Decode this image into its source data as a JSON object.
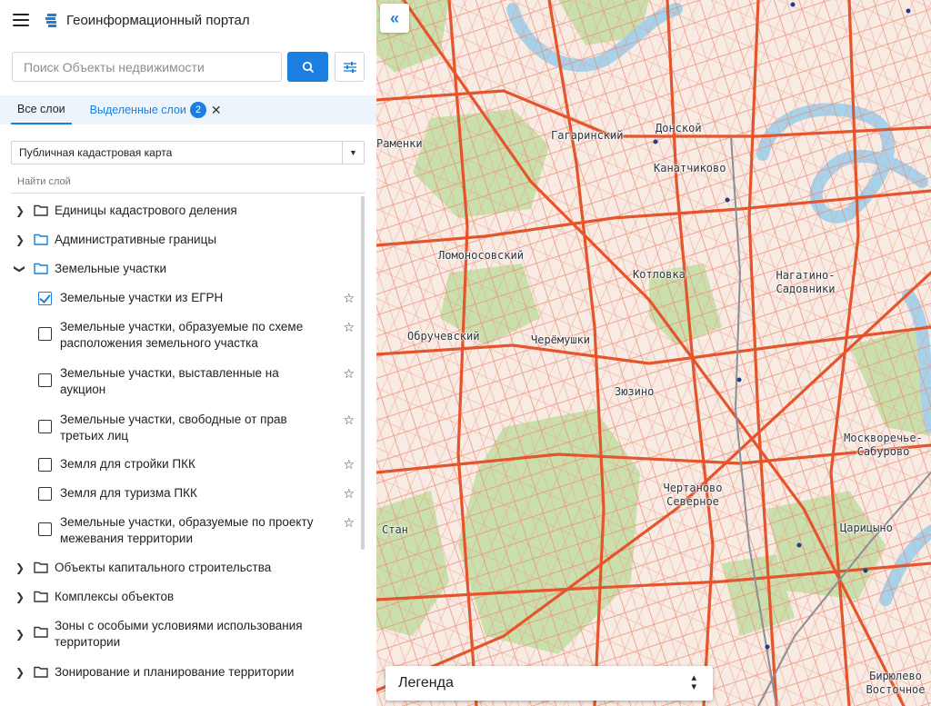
{
  "header": {
    "title": "Геоинформационный портал"
  },
  "search": {
    "placeholder": "Поиск Объекты недвижимости"
  },
  "tabs": {
    "all": "Все слои",
    "selected": "Выделенные слои",
    "selected_count": "2"
  },
  "basemap": {
    "selected": "Публичная кадастровая карта"
  },
  "find_layer": {
    "placeholder": "Найти слой"
  },
  "tree": [
    {
      "label": "Единицы кадастрового деления",
      "type": "folder",
      "expanded": false
    },
    {
      "label": "Административные границы",
      "type": "folder",
      "expanded": false
    },
    {
      "label": "Земельные участки",
      "type": "folder",
      "expanded": true
    },
    {
      "label": "Земельные участки из ЕГРН",
      "type": "layer",
      "checked": true
    },
    {
      "label": "Земельные участки, образуемые по схеме расположения земельного участка",
      "type": "layer",
      "checked": false
    },
    {
      "label": "Земельные участки, выставленные на аукцион",
      "type": "layer",
      "checked": false
    },
    {
      "label": "Земельные участки, свободные от прав третьих лиц",
      "type": "layer",
      "checked": false
    },
    {
      "label": "Земля для стройки ПКК",
      "type": "layer",
      "checked": false
    },
    {
      "label": "Земля для туризма ПКК",
      "type": "layer",
      "checked": false
    },
    {
      "label": "Земельные участки, образуемые по проекту межевания территории",
      "type": "layer",
      "checked": false
    },
    {
      "label": "Объекты капитального строительства",
      "type": "folder",
      "expanded": false
    },
    {
      "label": "Комплексы объектов",
      "type": "folder",
      "expanded": false
    },
    {
      "label": "Зоны с особыми условиями использования территории",
      "type": "folder",
      "expanded": false
    },
    {
      "label": "Зонирование и планирование территории",
      "type": "folder",
      "expanded": false
    }
  ],
  "map": {
    "legend_label": "Легенда",
    "labels": [
      "Раменки",
      "Гагаринский",
      "Донской",
      "Канатчиково",
      "Ломоносовский",
      "Котловка",
      "Нагатино-Садовники",
      "Обручевский",
      "Черёмушки",
      "Зюзино",
      "Москворечье-Сабурово",
      "Чертаново Северное",
      "Стан",
      "Царицыно",
      "Бирюлево Восточное"
    ]
  },
  "colors": {
    "accent": "#1a7fe0",
    "map_roads": "#e8603c",
    "map_green": "#c5dfa8",
    "map_water": "#a9d4ee"
  },
  "icons": [
    "menu-icon",
    "portal-logo-icon",
    "search-icon",
    "filter-icon",
    "close-icon",
    "chevron-right-icon",
    "chevron-down-icon",
    "folder-icon",
    "star-icon",
    "double-chevron-left-icon",
    "sort-icon"
  ]
}
